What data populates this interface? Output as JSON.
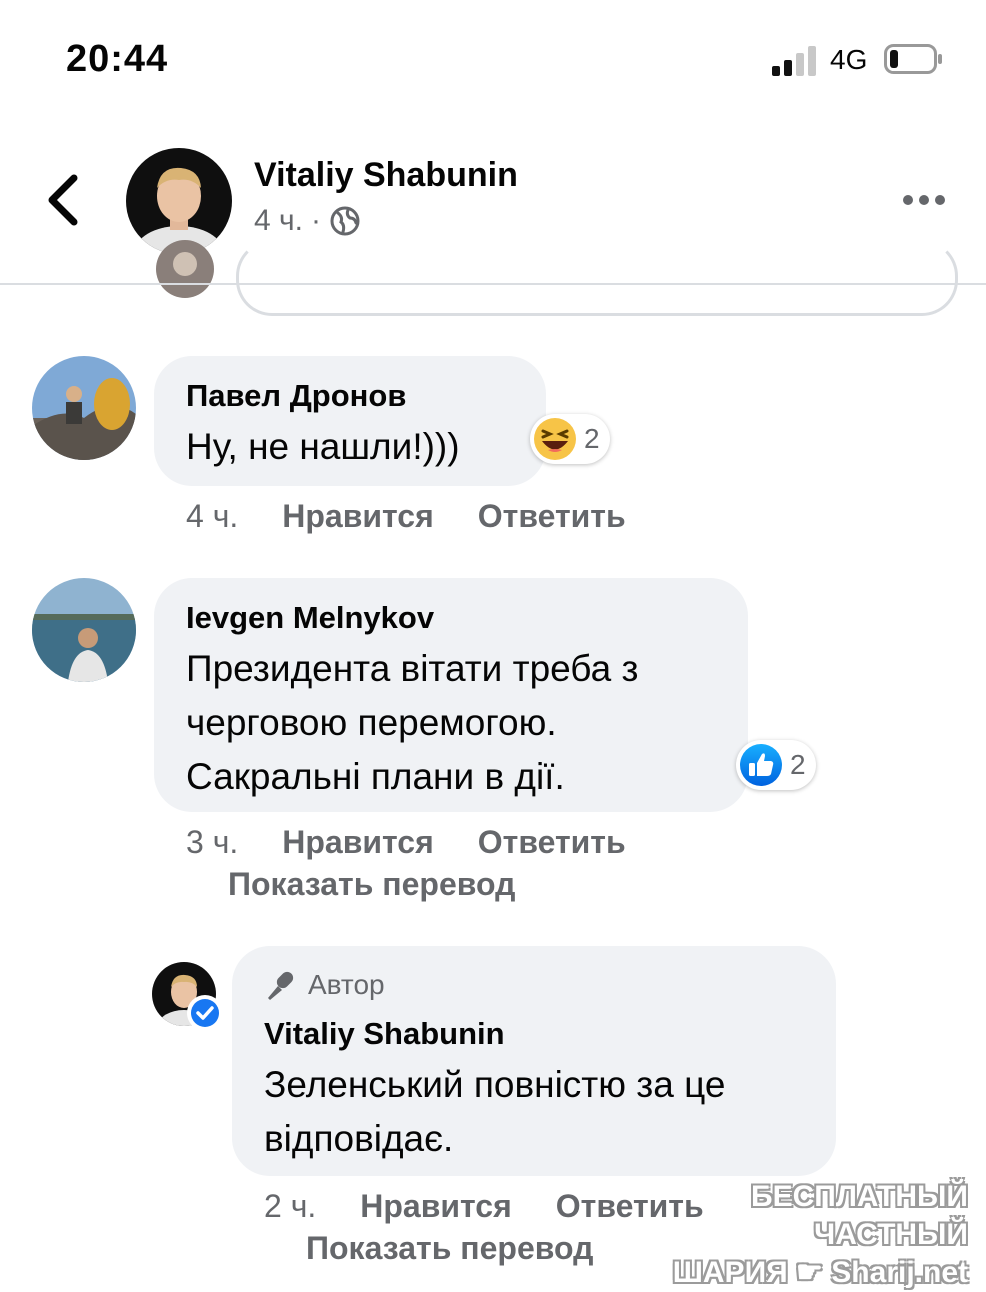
{
  "status_bar": {
    "time": "20:44",
    "network": "4G"
  },
  "header": {
    "name": "Vitaliy Shabunin",
    "time_ago": "4 ч.",
    "separator": "·"
  },
  "comments": [
    {
      "author": "Павел Дронов",
      "text": "Ну,  не нашли!)))",
      "reaction_count": "2",
      "reaction_icon": "laughing-emoji-icon",
      "time": "4 ч.",
      "like_label": "Нравится",
      "reply_label": "Ответить"
    },
    {
      "author": "Ievgen Melnykov",
      "text_lines": [
        "Президента вітати треба з",
        "черговою перемогою.",
        "Сакральні плани в дії."
      ],
      "reaction_count": "2",
      "reaction_icon": "like-thumb-icon",
      "time": "3 ч.",
      "like_label": "Нравится",
      "reply_label": "Ответить",
      "translate_label": "Показать перевод"
    },
    {
      "badge": "Автор",
      "author": "Vitaliy Shabunin",
      "text_lines": [
        "Зеленський повністю за це",
        "відповідає."
      ],
      "time": "2 ч.",
      "like_label": "Нравится",
      "reply_label": "Ответить",
      "translate_label": "Показать перевод"
    }
  ],
  "watermark": {
    "line1": "БЕСПЛАТНЫЙ ЧАСТНЫЙ",
    "line2": "ШАРИЯ",
    "line3": "Sharij.net"
  },
  "colors": {
    "accent": "#1877f2",
    "secondary_text": "#65676b",
    "bubble": "#f0f2f5"
  }
}
